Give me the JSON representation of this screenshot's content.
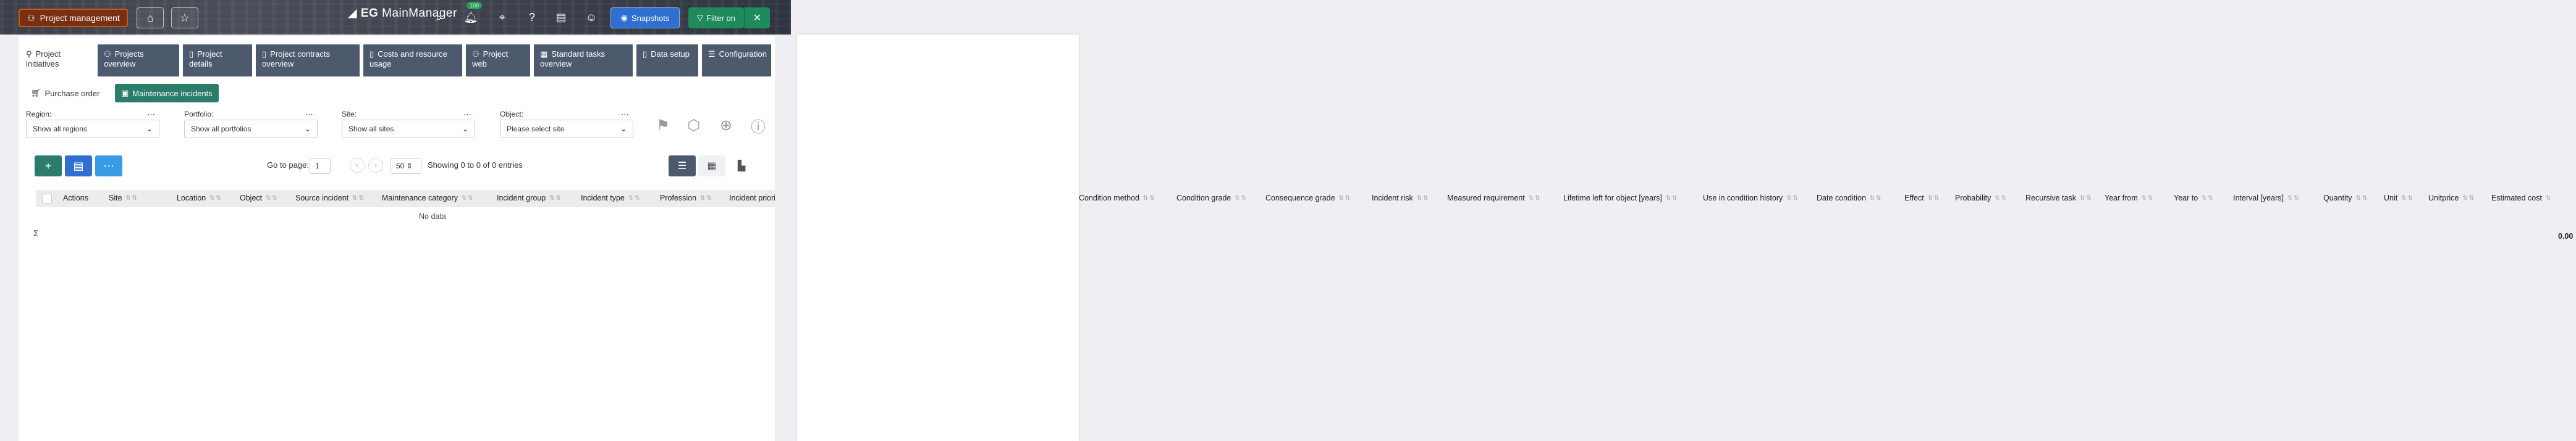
{
  "header": {
    "app_button": "Project management",
    "logo_prefix": "EG",
    "logo_name": "MainManager",
    "badge": "100",
    "snapshots": "Snapshots",
    "filter_on": "Filter on",
    "icons": [
      "home-icon",
      "star-icon",
      "search-icon",
      "bell-icon",
      "crosshair-icon",
      "help-icon",
      "book-icon",
      "user-icon"
    ]
  },
  "tabs": [
    {
      "label": "Project initiatives"
    },
    {
      "label": "Projects overview"
    },
    {
      "label": "Project details"
    },
    {
      "label": "Project contracts overview"
    },
    {
      "label": "Costs and resource usage"
    },
    {
      "label": "Project web"
    },
    {
      "label": "Standard tasks overview"
    },
    {
      "label": "Data setup"
    },
    {
      "label": "Configuration"
    }
  ],
  "subtabs": [
    {
      "label": "Purchase order"
    },
    {
      "label": "Maintenance incidents"
    }
  ],
  "filters": {
    "region_label": "Region:",
    "region_value": "Show all regions",
    "portfolio_label": "Portfolio:",
    "portfolio_value": "Show all portfolios",
    "site_label": "Site:",
    "site_value": "Show all sites",
    "object_label": "Object:",
    "object_value": "Please select site"
  },
  "pager": {
    "goto_label": "Go to page:",
    "page": "1",
    "page_size": "50",
    "showing": "Showing 0 to 0 of 0 entries"
  },
  "columns": [
    "Actions",
    "Site",
    "Location",
    "Object",
    "Source incident",
    "Maintenance category",
    "Incident group",
    "Incident type",
    "Profession",
    "Incident priority"
  ],
  "columns_right": [
    "Condition method",
    "Condition grade",
    "Consequence grade",
    "Incident risk",
    "Measured requirement",
    "Lifetime left for object [years]",
    "Use in condition history",
    "Date condition",
    "Effect",
    "Probability",
    "Recursive task",
    "Year from",
    "Year to",
    "Interval [years]",
    "Quantity",
    "Unit",
    "Unitprice",
    "Estimated cost"
  ],
  "table": {
    "no_data": "No data",
    "sigma": "Σ",
    "total": "0.00"
  },
  "colors": {
    "app_button": "#7a2f12",
    "snapshots": "#2f6fd0",
    "filter": "#1f8a5c",
    "tab_bg": "#4d5a6e",
    "subtab_active": "#2b7c6b"
  }
}
